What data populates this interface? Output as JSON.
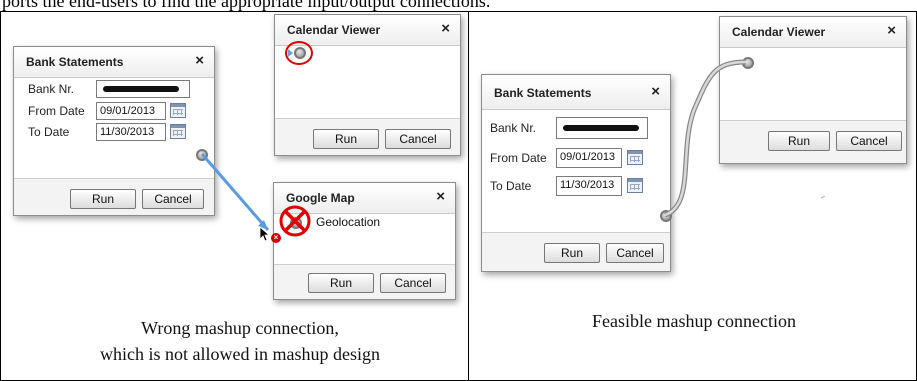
{
  "page": {
    "top_text": "ports the end-users to find the appropriate input/output connections."
  },
  "captions": {
    "left_line1": "Wrong mashup connection,",
    "left_line2": "which is not allowed in mashup design",
    "right": "Feasible mashup connection"
  },
  "widgets": {
    "bank": {
      "title": "Bank Statements",
      "close": "×",
      "bank_label": "Bank Nr.",
      "bank_value": "",
      "from_label": "From Date",
      "from_value": "09/01/2013",
      "to_label": "To Date",
      "to_value": "11/30/2013",
      "run": "Run",
      "cancel": "Cancel"
    },
    "calendar": {
      "title": "Calendar Viewer",
      "close": "×",
      "run": "Run",
      "cancel": "Cancel"
    },
    "map": {
      "title": "Google Map",
      "close": "×",
      "geolocation": "Geolocation",
      "run": "Run",
      "cancel": "Cancel"
    }
  },
  "colors": {
    "wrong_connection": "#5a9bde",
    "error_mark": "#e00000",
    "good_connection": "#9a9a9a"
  },
  "icons": [
    "close-icon",
    "calendar-icon",
    "port-icon",
    "error-cross-icon",
    "mouse-cursor-icon"
  ]
}
